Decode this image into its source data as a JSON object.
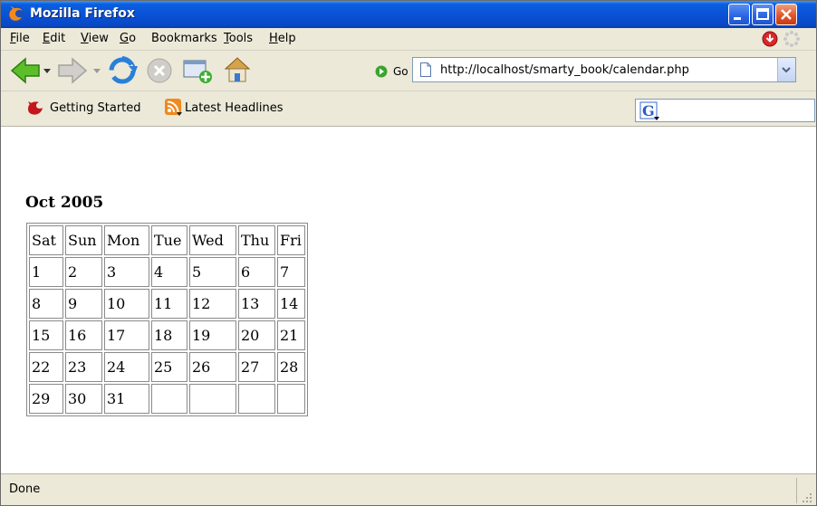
{
  "window": {
    "title": "Mozilla Firefox"
  },
  "menu": [
    "File",
    "Edit",
    "View",
    "Go",
    "Bookmarks",
    "Tools",
    "Help"
  ],
  "menu_access": [
    "F",
    "E",
    "V",
    "G",
    "T",
    "H"
  ],
  "nav": {
    "go_label": "Go",
    "url": "http://localhost/smarty_book/calendar.php"
  },
  "bookmarks": [
    {
      "label": "Getting Started",
      "icon": "firefox-red-icon"
    },
    {
      "label": "Latest Headlines",
      "icon": "rss-feed-icon"
    }
  ],
  "search": {
    "engine_icon": "google-icon",
    "value": ""
  },
  "calendar": {
    "title": "Oct 2005",
    "headers": [
      "Sat",
      "Sun",
      "Mon",
      "Tue",
      "Wed",
      "Thu",
      "Fri"
    ],
    "rows": [
      [
        "1",
        "2",
        "3",
        "4",
        "5",
        "6",
        "7"
      ],
      [
        "8",
        "9",
        "10",
        "11",
        "12",
        "13",
        "14"
      ],
      [
        "15",
        "16",
        "17",
        "18",
        "19",
        "20",
        "21"
      ],
      [
        "22",
        "23",
        "24",
        "25",
        "26",
        "27",
        "28"
      ],
      [
        "29",
        "30",
        "31",
        "",
        "",
        "",
        ""
      ]
    ]
  },
  "status": {
    "text": "Done"
  },
  "colors": {
    "titlebar": "#0a52d6",
    "chrome": "#ece9d8",
    "close": "#e0552c"
  }
}
